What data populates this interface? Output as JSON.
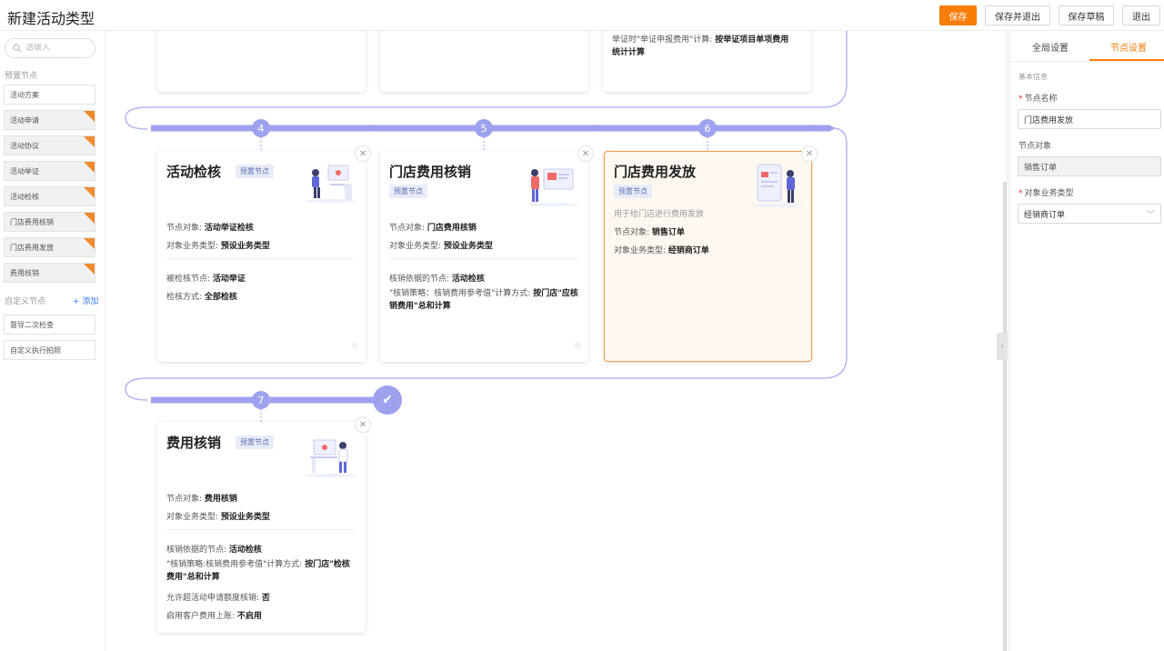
{
  "header": {
    "title": "新建活动类型",
    "buttons": {
      "save": "保存",
      "save_exit": "保存并退出",
      "save_draft": "保存草稿",
      "exit": "退出"
    }
  },
  "left": {
    "search_placeholder": "请输入",
    "preset_label": "预置节点",
    "preset_nodes": [
      "活动方案",
      "活动申请",
      "活动协议",
      "活动举证",
      "活动检核",
      "门店费用核销",
      "门店费用发放",
      "费用核销"
    ],
    "custom_label": "自定义节点",
    "add_label": "+ 添加",
    "custom_nodes": [
      "督导二次检查",
      "自定义执行拍照"
    ]
  },
  "flow": {
    "top_partial_text": [
      "举证时\"举证申报费用\"计算:",
      "按举证项目单项费用",
      "统计计算"
    ],
    "steps": [
      "4",
      "5",
      "6",
      "7"
    ],
    "cards": {
      "check": {
        "title": "活动检核",
        "tag": "预置节点",
        "l1_k": "节点对象: ",
        "l1_v": "活动举证检核",
        "l2_k": "对象业务类型: ",
        "l2_v": "预设业务类型",
        "l3_k": "被检核节点: ",
        "l3_v": "活动举证",
        "l4_k": "检核方式: ",
        "l4_v": "全部检核"
      },
      "store_verify": {
        "title": "门店费用核销",
        "tag": "预置节点",
        "l1_k": "节点对象: ",
        "l1_v": "门店费用核销",
        "l2_k": "对象业务类型: ",
        "l2_v": "预设业务类型",
        "l3_k": "核销依据的节点: ",
        "l3_v": "活动检核",
        "l4_k": "\"核销策略：核销费用参考值\"计算方式: ",
        "l4_v": "按门店\"应核销费用\"总和计算"
      },
      "store_issue": {
        "title": "门店费用发放",
        "tag": "预置节点",
        "desc": "用于给门店进行费用发放",
        "l1_k": "节点对象: ",
        "l1_v": "销售订单",
        "l2_k": "对象业务类型: ",
        "l2_v": "经销商订单"
      },
      "fee_verify": {
        "title": "费用核销",
        "tag": "预置节点",
        "l1_k": "节点对象: ",
        "l1_v": "费用核销",
        "l2_k": "对象业务类型: ",
        "l2_v": "预设业务类型",
        "l3_k": "核销依据的节点: ",
        "l3_v": "活动检核",
        "l4_k": "\"核销策略:核销费用参考值\"计算方式: ",
        "l4_v": "按门店\"检核费用\"总和计算",
        "l5_k": "允许超活动申请额度核销: ",
        "l5_v": "否",
        "l6_k": "启用客户费用上账: ",
        "l6_v": "不启用"
      }
    }
  },
  "right": {
    "tabs": [
      "全局设置",
      "节点设置"
    ],
    "section": "基本信息",
    "node_name_label": "节点名称",
    "node_name_value": "门店费用发放",
    "node_object_label": "节点对象",
    "node_object_value": "销售订单",
    "biz_type_label": "对象业务类型",
    "biz_type_value": "经销商订单"
  },
  "colors": {
    "accent": "#fa7d09",
    "flow": "#9ea2ee",
    "flag": "#f08a2c"
  }
}
